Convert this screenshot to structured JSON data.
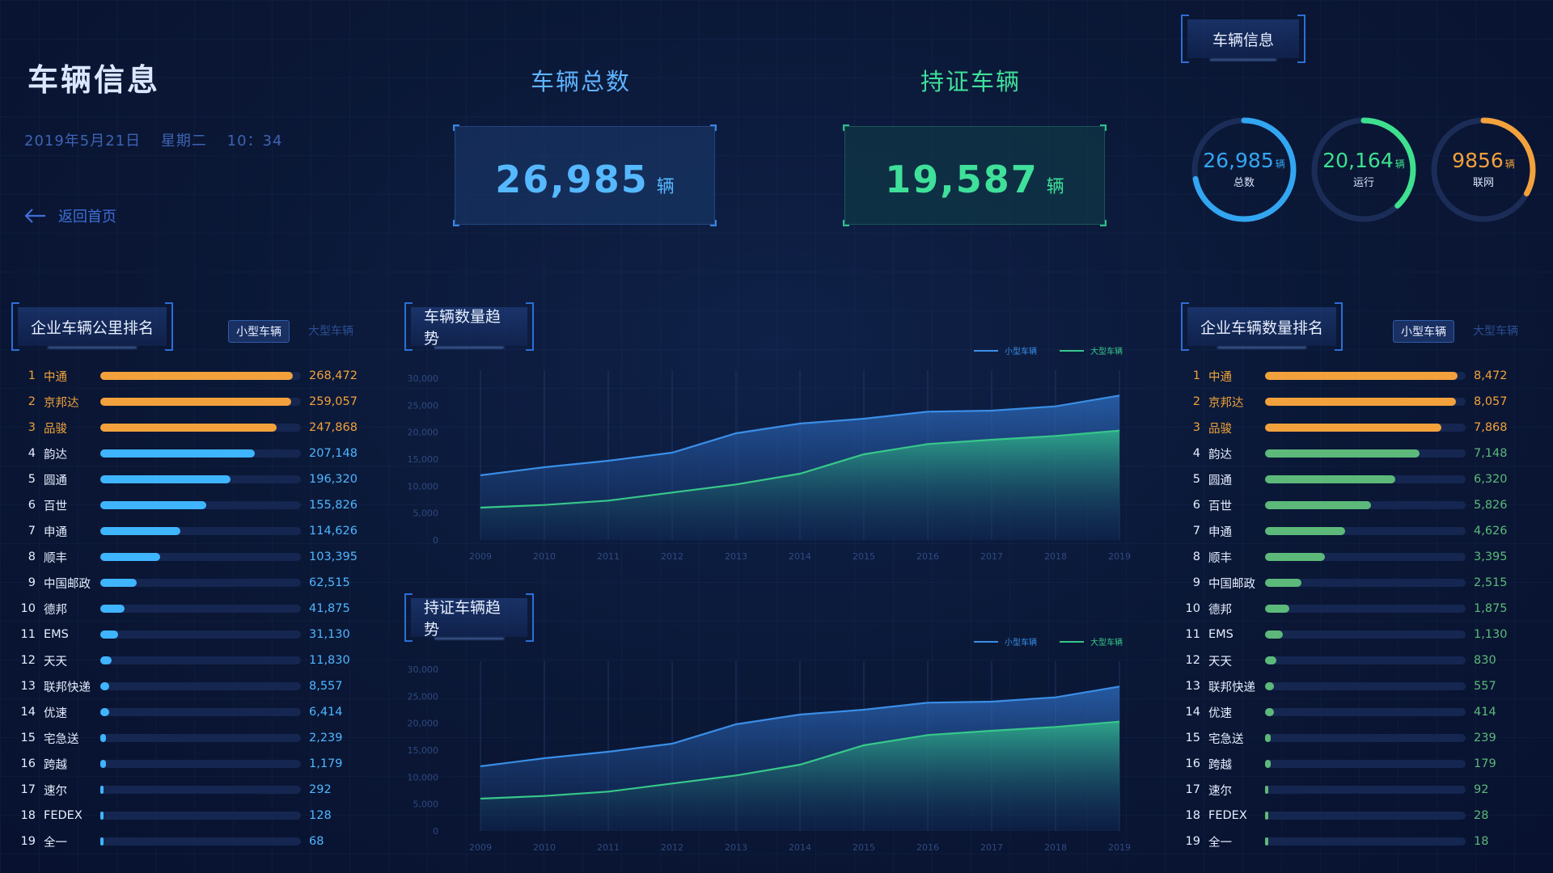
{
  "page": {
    "title": "车辆信息",
    "date": "2019年5月21日",
    "weekday": "星期二",
    "time": "10：34",
    "back_label": "返回首页"
  },
  "kpis": {
    "total": {
      "title": "车辆总数",
      "value": "26,985",
      "unit": "辆"
    },
    "certified": {
      "title": "持证车辆",
      "value": "19,587",
      "unit": "辆"
    }
  },
  "vehicle_info": {
    "title": "车辆信息",
    "rings": [
      {
        "value": "26,985",
        "unit": "辆",
        "label": "总数",
        "percent": 0.72,
        "color": "#33a6f2"
      },
      {
        "value": "20,164",
        "unit": "辆",
        "label": "运行",
        "percent": 0.38,
        "color": "#3ee08f"
      },
      {
        "value": "9856",
        "unit": "辆",
        "label": "联网",
        "percent": 0.33,
        "color": "#f3a13c"
      }
    ]
  },
  "left_panel": {
    "title": "企业车辆公里排名",
    "tab_active": "小型车辆",
    "tab_inactive": "大型车辆",
    "bar_color": "#3fb4ff",
    "top_color": "#f3a13c",
    "rows": [
      {
        "rank": "1",
        "name": "中通",
        "value": "268,472",
        "ratio": 0.96
      },
      {
        "rank": "2",
        "name": "京邦达",
        "value": "259,057",
        "ratio": 0.95
      },
      {
        "rank": "3",
        "name": "品骏",
        "value": "247,868",
        "ratio": 0.88
      },
      {
        "rank": "4",
        "name": "韵达",
        "value": "207,148",
        "ratio": 0.77
      },
      {
        "rank": "5",
        "name": "圆通",
        "value": "196,320",
        "ratio": 0.65
      },
      {
        "rank": "6",
        "name": "百世",
        "value": "155,826",
        "ratio": 0.53
      },
      {
        "rank": "7",
        "name": "申通",
        "value": "114,626",
        "ratio": 0.4
      },
      {
        "rank": "8",
        "name": "顺丰",
        "value": "103,395",
        "ratio": 0.3
      },
      {
        "rank": "9",
        "name": "中国邮政",
        "value": "62,515",
        "ratio": 0.18
      },
      {
        "rank": "10",
        "name": "德邦",
        "value": "41,875",
        "ratio": 0.12
      },
      {
        "rank": "11",
        "name": "EMS",
        "value": "31,130",
        "ratio": 0.09
      },
      {
        "rank": "12",
        "name": "天天",
        "value": "11,830",
        "ratio": 0.055
      },
      {
        "rank": "13",
        "name": "联邦快递",
        "value": "8,557",
        "ratio": 0.045
      },
      {
        "rank": "14",
        "name": "优速",
        "value": "6,414",
        "ratio": 0.045
      },
      {
        "rank": "15",
        "name": "宅急送",
        "value": "2,239",
        "ratio": 0.03
      },
      {
        "rank": "16",
        "name": "跨越",
        "value": "1,179",
        "ratio": 0.03
      },
      {
        "rank": "17",
        "name": "速尔",
        "value": "292",
        "ratio": 0.012
      },
      {
        "rank": "18",
        "name": "FEDEX",
        "value": "128",
        "ratio": 0.01
      },
      {
        "rank": "19",
        "name": "全一",
        "value": "68",
        "ratio": 0.01
      }
    ]
  },
  "right_panel": {
    "title": "企业车辆数量排名",
    "tab_active": "小型车辆",
    "tab_inactive": "大型车辆",
    "bar_color": "#5cb97a",
    "top_color": "#f3a13c",
    "rows": [
      {
        "rank": "1",
        "name": "中通",
        "value": "8,472",
        "ratio": 0.96
      },
      {
        "rank": "2",
        "name": "京邦达",
        "value": "8,057",
        "ratio": 0.95
      },
      {
        "rank": "3",
        "name": "品骏",
        "value": "7,868",
        "ratio": 0.88
      },
      {
        "rank": "4",
        "name": "韵达",
        "value": "7,148",
        "ratio": 0.77
      },
      {
        "rank": "5",
        "name": "圆通",
        "value": "6,320",
        "ratio": 0.65
      },
      {
        "rank": "6",
        "name": "百世",
        "value": "5,826",
        "ratio": 0.53
      },
      {
        "rank": "7",
        "name": "申通",
        "value": "4,626",
        "ratio": 0.4
      },
      {
        "rank": "8",
        "name": "顺丰",
        "value": "3,395",
        "ratio": 0.3
      },
      {
        "rank": "9",
        "name": "中国邮政",
        "value": "2,515",
        "ratio": 0.18
      },
      {
        "rank": "10",
        "name": "德邦",
        "value": "1,875",
        "ratio": 0.12
      },
      {
        "rank": "11",
        "name": "EMS",
        "value": "1,130",
        "ratio": 0.09
      },
      {
        "rank": "12",
        "name": "天天",
        "value": "830",
        "ratio": 0.055
      },
      {
        "rank": "13",
        "name": "联邦快递",
        "value": "557",
        "ratio": 0.045
      },
      {
        "rank": "14",
        "name": "优速",
        "value": "414",
        "ratio": 0.045
      },
      {
        "rank": "15",
        "name": "宅急送",
        "value": "239",
        "ratio": 0.03
      },
      {
        "rank": "16",
        "name": "跨越",
        "value": "179",
        "ratio": 0.03
      },
      {
        "rank": "17",
        "name": "速尔",
        "value": "92",
        "ratio": 0.012
      },
      {
        "rank": "18",
        "name": "FEDEX",
        "value": "28",
        "ratio": 0.01
      },
      {
        "rank": "19",
        "name": "全一",
        "value": "18",
        "ratio": 0.01
      }
    ]
  },
  "chart_data": [
    {
      "type": "area",
      "title": "车辆数量趋势",
      "x": [
        "2009",
        "2010",
        "2011",
        "2012",
        "2013",
        "2014",
        "2015",
        "2016",
        "2017",
        "2018",
        "2019"
      ],
      "ylim": [
        0,
        30000
      ],
      "yticks": [
        "0",
        "5,000",
        "10,000",
        "15,000",
        "20,000",
        "25,000",
        "30,000"
      ],
      "grid": true,
      "legend": "top-right",
      "series": [
        {
          "name": "小型车辆",
          "color": "#3a8ee6",
          "values": [
            12000,
            13500,
            14700,
            16200,
            19800,
            21600,
            22500,
            23800,
            24000,
            24800,
            26800
          ]
        },
        {
          "name": "大型车辆",
          "color": "#37c88a",
          "values": [
            6000,
            6500,
            7300,
            8800,
            10300,
            12300,
            15900,
            17800,
            18600,
            19300,
            20300
          ]
        }
      ]
    },
    {
      "type": "area",
      "title": "持证车辆趋势",
      "x": [
        "2009",
        "2010",
        "2011",
        "2012",
        "2013",
        "2014",
        "2015",
        "2016",
        "2017",
        "2018",
        "2019"
      ],
      "ylim": [
        0,
        30000
      ],
      "yticks": [
        "0",
        "5,000",
        "10,000",
        "15,000",
        "20,000",
        "25,000",
        "30,000"
      ],
      "grid": true,
      "legend": "top-right",
      "series": [
        {
          "name": "小型车辆",
          "color": "#3a8ee6",
          "values": [
            12000,
            13500,
            14700,
            16200,
            19800,
            21600,
            22500,
            23800,
            24000,
            24800,
            26800
          ]
        },
        {
          "name": "大型车辆",
          "color": "#37c88a",
          "values": [
            6000,
            6500,
            7300,
            8800,
            10300,
            12300,
            15900,
            17800,
            18600,
            19300,
            20300
          ]
        }
      ]
    }
  ]
}
